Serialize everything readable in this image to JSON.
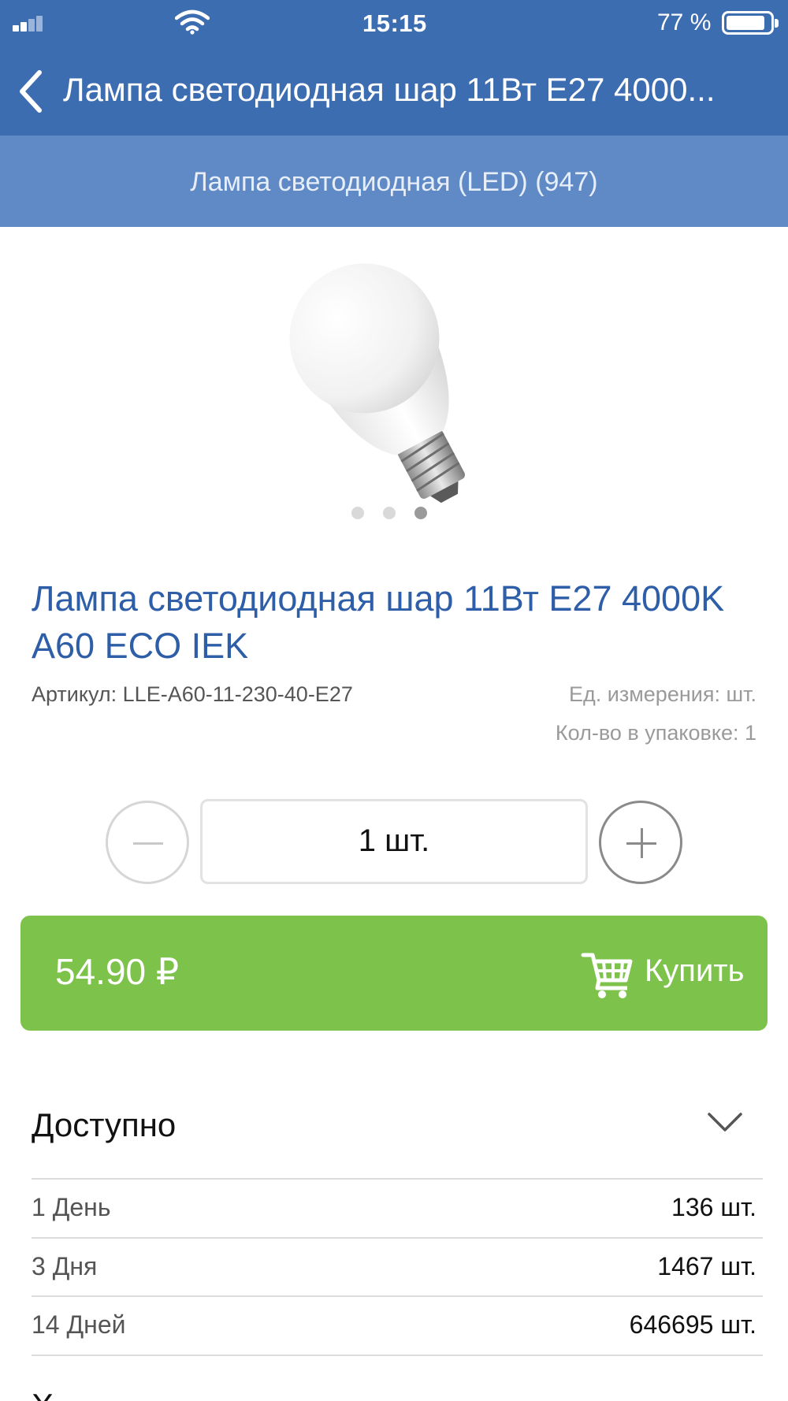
{
  "status_bar": {
    "time": "15:15",
    "battery": "77 %",
    "icons": [
      "signal-icon",
      "wifi-icon",
      "battery-icon"
    ]
  },
  "nav": {
    "back_icon": "chevron-left-icon",
    "title": "Лампа светодиодная шар 11Вт E27 4000..."
  },
  "category": {
    "label": "Лампа светодиодная (LED) (947)"
  },
  "gallery": {
    "image": "led-bulb-image",
    "total_images": 3,
    "active_index": 2
  },
  "product": {
    "title": "Лампа светодиодная шар 11Вт E27 4000K A60 ECO IEK",
    "article": "Артикул: LLE-A60-11-230-40-E27",
    "unit": "Ед. измерения: шт.",
    "pack": "Кол-во в упаковке: 1"
  },
  "quantity": {
    "value": "1 шт.",
    "minus_icon": "minus-icon",
    "plus_icon": "plus-icon"
  },
  "buy": {
    "price": "54.90 ₽",
    "label": "Купить",
    "icon": "cart-icon"
  },
  "availability": {
    "heading": "Доступно",
    "rows": [
      {
        "label": "1 День",
        "value": "136 шт."
      },
      {
        "label": "3 Дня",
        "value": "1467 шт."
      },
      {
        "label": "14 Дней",
        "value": "646695 шт."
      }
    ],
    "next_heading": "Х"
  },
  "colors": {
    "nav_bg": "#3d6db1",
    "category_bg": "#5f8ac6",
    "title_blue": "#2d5ea7",
    "buy_green": "#7dc24b"
  }
}
